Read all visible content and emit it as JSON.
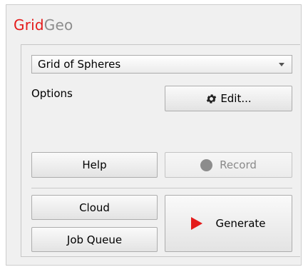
{
  "title": {
    "part1": "Grid",
    "part2": "Geo"
  },
  "generator_select": {
    "value": "Grid of Spheres"
  },
  "options": {
    "label": "Options",
    "edit_label": "Edit..."
  },
  "buttons": {
    "help": "Help",
    "record": "Record",
    "cloud": "Cloud",
    "job_queue": "Job Queue",
    "generate": "Generate"
  },
  "colors": {
    "accent": "#e41b1b",
    "muted": "#8d8d8d"
  },
  "icons": {
    "edit": "gear-icon",
    "record": "record-dot-icon",
    "generate": "play-icon"
  }
}
